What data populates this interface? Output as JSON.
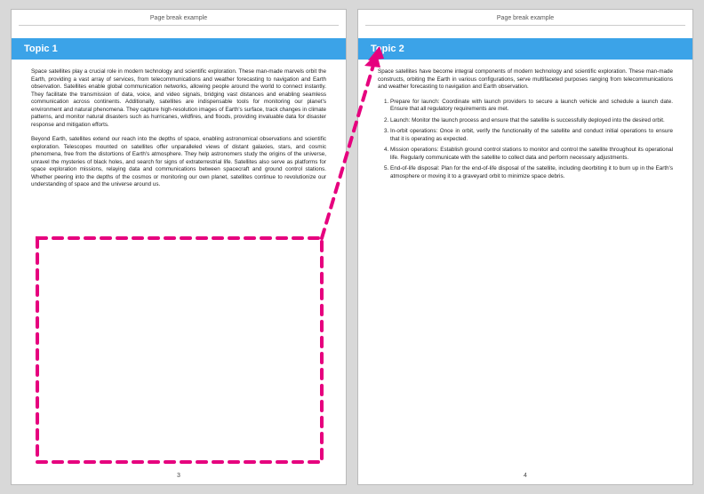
{
  "header": {
    "text": "Page break example"
  },
  "accent_color": "#3ba3e8",
  "annotation_color": "#e6007e",
  "pages": [
    {
      "number": "3",
      "topic": "Topic 1",
      "paragraphs": [
        "Space satellites play a crucial role in modern technology and scientific exploration. These man-made marvels orbit the Earth, providing a vast array of services, from telecommunications and weather forecasting to navigation and Earth observation. Satellites enable global communication networks, allowing people around the world to connect instantly. They facilitate the transmission of data, voice, and video signals, bridging vast distances and enabling seamless communication across continents. Additionally, satellites are indispensable tools for monitoring our planet's environment and natural phenomena. They capture high-resolution images of Earth's surface, track changes in climate patterns, and monitor natural disasters such as hurricanes, wildfires, and floods, providing invaluable data for disaster response and mitigation efforts.",
        "Beyond Earth, satellites extend our reach into the depths of space, enabling astronomical observations and scientific exploration. Telescopes mounted on satellites offer unparalleled views of distant galaxies, stars, and cosmic phenomena, free from the distortions of Earth's atmosphere. They help astronomers study the origins of the universe, unravel the mysteries of black holes, and search for signs of extraterrestrial life. Satellites also serve as platforms for space exploration missions, relaying data and communications between spacecraft and ground control stations. Whether peering into the depths of the cosmos or monitoring our own planet, satellites continue to revolutionize our understanding of space and the universe around us."
      ]
    },
    {
      "number": "4",
      "topic": "Topic 2",
      "intro": "Space satellites have become integral components of modern technology and scientific exploration. These man-made constructs, orbiting the Earth in various configurations, serve multifaceted purposes ranging from telecommunications and weather forecasting to navigation and Earth observation.",
      "list": [
        "Prepare for launch: Coordinate with launch providers to secure a launch vehicle and schedule a launch date. Ensure that all regulatory requirements are met.",
        "Launch: Monitor the launch process and ensure that the satellite is successfully deployed into the desired orbit.",
        "In-orbit operations: Once in orbit, verify the functionality of the satellite and conduct initial operations to ensure that it is operating as expected.",
        "Mission operations: Establish ground control stations to monitor and control the satellite throughout its operational life. Regularly communicate with the satellite to collect data and perform necessary adjustments.",
        "End-of-life disposal: Plan for the end-of-life disposal of the satellite, including deorbiting it to burn up in the Earth's atmosphere or moving it to a graveyard orbit to minimize space debris."
      ]
    }
  ],
  "annotation": {
    "type": "dashed-box-with-arrow",
    "description": "A magenta dashed rectangle highlighting the empty lower region of page 3, with a dashed arrow pointing from its top-right corner to the Topic 2 heading on page 4."
  }
}
